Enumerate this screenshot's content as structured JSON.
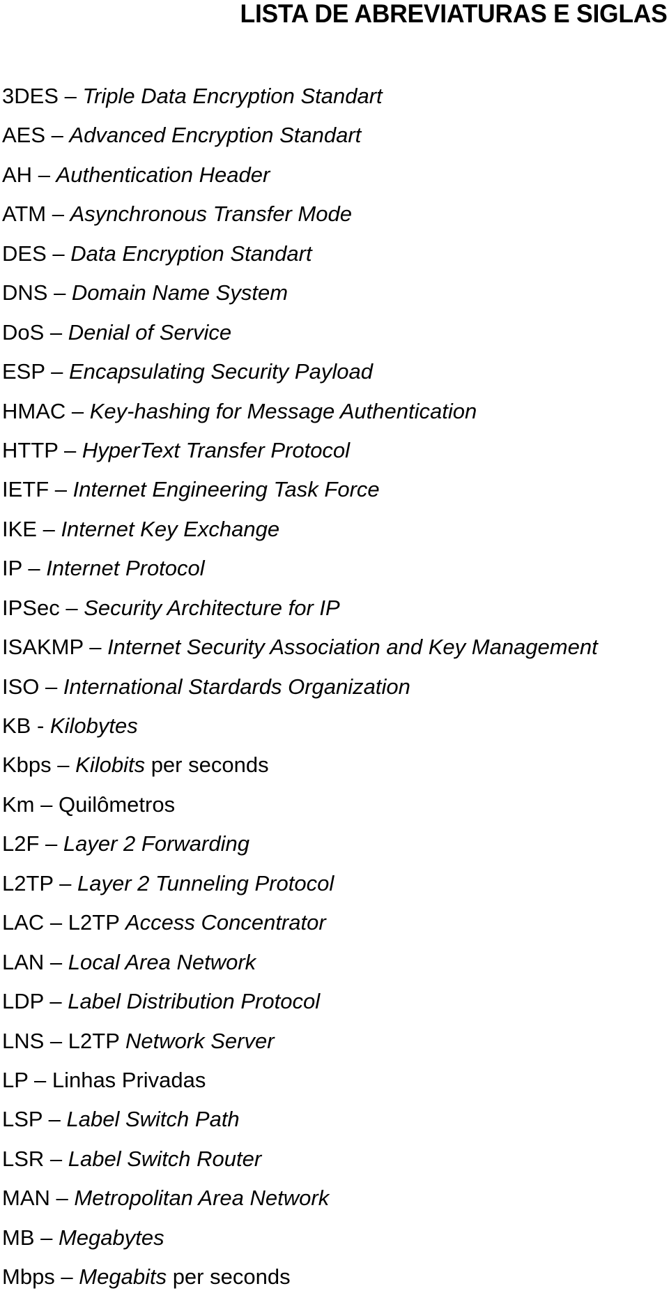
{
  "document": {
    "title": "LISTA DE ABREVIATURAS E SIGLAS",
    "entries": [
      {
        "abbr": "3DES",
        "sep": " – ",
        "parts": [
          {
            "text": "Triple Data Encryption Standart",
            "italic": true
          }
        ]
      },
      {
        "abbr": "AES",
        "sep": " – ",
        "parts": [
          {
            "text": "Advanced Encryption Standart",
            "italic": true
          }
        ]
      },
      {
        "abbr": "AH",
        "sep": " – ",
        "parts": [
          {
            "text": "Authentication Header",
            "italic": true
          }
        ]
      },
      {
        "abbr": "ATM",
        "sep": " – ",
        "parts": [
          {
            "text": "Asynchronous Transfer Mode",
            "italic": true
          }
        ]
      },
      {
        "abbr": "DES",
        "sep": " – ",
        "parts": [
          {
            "text": "Data Encryption Standart",
            "italic": true
          }
        ]
      },
      {
        "abbr": "DNS",
        "sep": " – ",
        "parts": [
          {
            "text": "Domain Name System",
            "italic": true
          }
        ]
      },
      {
        "abbr": "DoS",
        "sep": " – ",
        "parts": [
          {
            "text": "Denial of Service",
            "italic": true
          }
        ]
      },
      {
        "abbr": "ESP",
        "sep": " – ",
        "parts": [
          {
            "text": "Encapsulating Security Payload",
            "italic": true
          }
        ]
      },
      {
        "abbr": "HMAC",
        "sep": " – ",
        "parts": [
          {
            "text": "Key-hashing for Message Authentication",
            "italic": true
          }
        ]
      },
      {
        "abbr": "HTTP",
        "sep": " – ",
        "parts": [
          {
            "text": "HyperText Transfer Protocol",
            "italic": true
          }
        ]
      },
      {
        "abbr": "IETF",
        "sep": " – ",
        "parts": [
          {
            "text": "Internet Engineering Task Force",
            "italic": true
          }
        ]
      },
      {
        "abbr": "IKE",
        "sep": " – ",
        "parts": [
          {
            "text": "Internet Key Exchange",
            "italic": true
          }
        ]
      },
      {
        "abbr": "IP",
        "sep": " – ",
        "parts": [
          {
            "text": "Internet Protocol",
            "italic": true
          }
        ]
      },
      {
        "abbr": "IPSec",
        "sep": " – ",
        "parts": [
          {
            "text": "Security Architecture for IP",
            "italic": true
          }
        ]
      },
      {
        "abbr": "ISAKMP",
        "sep": " – ",
        "parts": [
          {
            "text": "Internet Security Association and Key Management",
            "italic": true
          }
        ]
      },
      {
        "abbr": "ISO",
        "sep": " – ",
        "parts": [
          {
            "text": "International Stardards Organization",
            "italic": true
          }
        ]
      },
      {
        "abbr": "KB",
        "sep": " - ",
        "parts": [
          {
            "text": "Kilobytes",
            "italic": true
          }
        ]
      },
      {
        "abbr": "Kbps",
        "sep": " – ",
        "parts": [
          {
            "text": "Kilobits",
            "italic": true
          },
          {
            "text": " per seconds",
            "italic": false
          }
        ]
      },
      {
        "abbr": "Km",
        "sep": " – ",
        "parts": [
          {
            "text": "Quilômetros",
            "italic": false
          }
        ]
      },
      {
        "abbr": "L2F",
        "sep": " – ",
        "parts": [
          {
            "text": "Layer 2 Forwarding",
            "italic": true
          }
        ]
      },
      {
        "abbr": "L2TP",
        "sep": " – ",
        "parts": [
          {
            "text": "Layer 2 Tunneling Protocol",
            "italic": true
          }
        ]
      },
      {
        "abbr": "LAC",
        "sep": " – ",
        "parts": [
          {
            "text": "L2TP ",
            "italic": false
          },
          {
            "text": "Access Concentrator",
            "italic": true
          }
        ]
      },
      {
        "abbr": "LAN",
        "sep": " – ",
        "parts": [
          {
            "text": "Local Area Network",
            "italic": true
          }
        ]
      },
      {
        "abbr": "LDP",
        "sep": " – ",
        "parts": [
          {
            "text": "Label Distribution Protocol",
            "italic": true
          }
        ]
      },
      {
        "abbr": "LNS",
        "sep": " – ",
        "parts": [
          {
            "text": "L2TP ",
            "italic": false
          },
          {
            "text": "Network Server",
            "italic": true
          }
        ]
      },
      {
        "abbr": "LP",
        "sep": " – ",
        "parts": [
          {
            "text": "Linhas Privadas",
            "italic": false
          }
        ]
      },
      {
        "abbr": "LSP",
        "sep": " – ",
        "parts": [
          {
            "text": "Label Switch Path",
            "italic": true
          }
        ]
      },
      {
        "abbr": "LSR",
        "sep": " – ",
        "parts": [
          {
            "text": "Label Switch Router",
            "italic": true
          }
        ]
      },
      {
        "abbr": "MAN",
        "sep": " – ",
        "parts": [
          {
            "text": "Metropolitan Area Network",
            "italic": true
          }
        ]
      },
      {
        "abbr": "MB",
        "sep": " – ",
        "parts": [
          {
            "text": "Megabytes",
            "italic": true
          }
        ]
      },
      {
        "abbr": "Mbps",
        "sep": " – ",
        "parts": [
          {
            "text": "Megabits",
            "italic": true
          },
          {
            "text": " per seconds",
            "italic": false
          }
        ]
      }
    ]
  }
}
